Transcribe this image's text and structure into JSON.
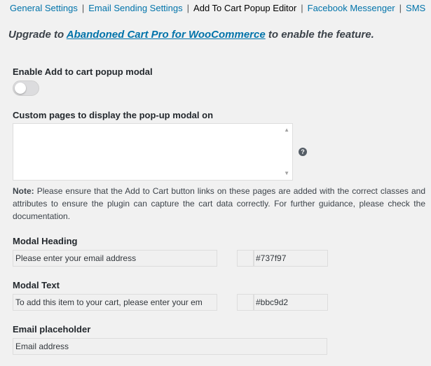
{
  "tabs": [
    {
      "label": "General Settings",
      "current": false
    },
    {
      "label": "Email Sending Settings",
      "current": false
    },
    {
      "label": "Add To Cart Popup Editor",
      "current": true
    },
    {
      "label": "Facebook Messenger",
      "current": false
    },
    {
      "label": "SMS",
      "current": false
    }
  ],
  "upgrade": {
    "prefix": "Upgrade to ",
    "link": "Abandoned Cart Pro for WooCommerce",
    "suffix": " to enable the feature."
  },
  "enable_modal": {
    "label": "Enable Add to cart popup modal",
    "enabled": false
  },
  "custom_pages": {
    "label": "Custom pages to display the pop-up modal on",
    "value": "",
    "help_icon": "question-icon"
  },
  "note": {
    "bold": "Note:",
    "text": " Please ensure that the Add to Cart button links on these pages are added with the correct classes and attributes to ensure the plugin can capture the cart data correctly. For further guidance, please check the documentation."
  },
  "modal_heading": {
    "label": "Modal Heading",
    "value": "Please enter your email address",
    "color": "#737f97"
  },
  "modal_text": {
    "label": "Modal Text",
    "value": "To add this item to your cart, please enter your em",
    "color": "#bbc9d2"
  },
  "email_placeholder": {
    "label": "Email placeholder",
    "value": "Email address"
  },
  "colors": {
    "link": "#0073aa",
    "background": "#f1f1f1",
    "toggle_off": "#dcdcde"
  }
}
